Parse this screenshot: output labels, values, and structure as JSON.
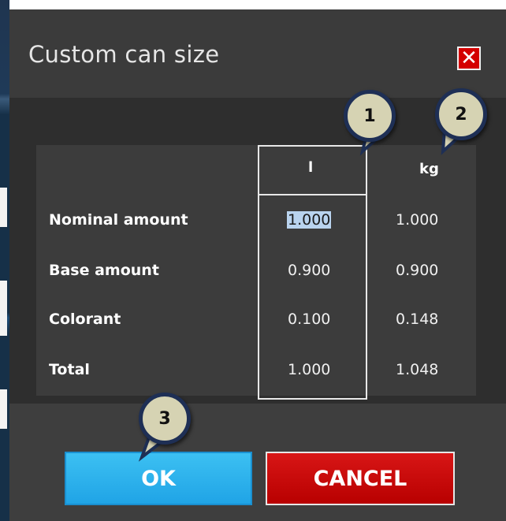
{
  "dialog": {
    "title": "Custom can size",
    "close_label": "✕"
  },
  "table": {
    "headers": {
      "liter": "l",
      "kg": "kg"
    },
    "rows": [
      {
        "label": "Nominal amount",
        "liter": "1.000",
        "kg": "1.000"
      },
      {
        "label": "Base amount",
        "liter": "0.900",
        "kg": "0.900"
      },
      {
        "label": "Colorant",
        "liter": "0.100",
        "kg": "0.148"
      },
      {
        "label": "Total",
        "liter": "1.000",
        "kg": "1.048"
      }
    ],
    "selected_cell": "rows.0.liter"
  },
  "buttons": {
    "ok": "OK",
    "cancel": "CANCEL"
  },
  "callouts": {
    "one": "1",
    "two": "2",
    "three": "3"
  },
  "colors": {
    "accent_ok": "#20a4e6",
    "accent_cancel": "#c40000",
    "close_red": "#d40000",
    "callout_border": "#1e2f55",
    "callout_fill": "#d6d3b3"
  }
}
